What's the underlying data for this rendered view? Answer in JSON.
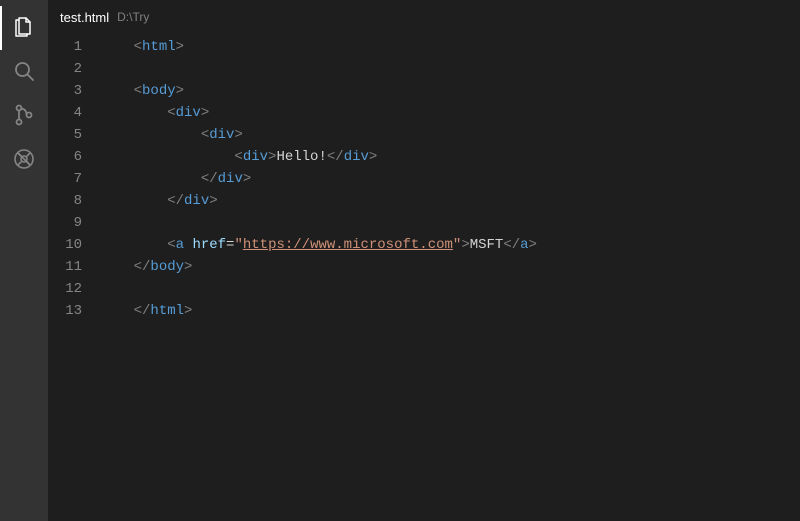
{
  "activityBar": {
    "items": [
      {
        "name": "explorer",
        "active": true
      },
      {
        "name": "search",
        "active": false
      },
      {
        "name": "sourceControl",
        "active": false
      },
      {
        "name": "debug",
        "active": false
      }
    ]
  },
  "tab": {
    "filename": "test.html",
    "pathLabel": "D:\\Try"
  },
  "editor": {
    "lineNumbers": [
      "1",
      "2",
      "3",
      "4",
      "5",
      "6",
      "7",
      "8",
      "9",
      "10",
      "11",
      "12",
      "13"
    ],
    "lines": [
      {
        "indent": 1,
        "segs": [
          {
            "t": "<",
            "c": "punc"
          },
          {
            "t": "html",
            "c": "tag"
          },
          {
            "t": ">",
            "c": "punc"
          }
        ]
      },
      {
        "indent": 0,
        "segs": []
      },
      {
        "indent": 1,
        "segs": [
          {
            "t": "<",
            "c": "punc"
          },
          {
            "t": "body",
            "c": "tag"
          },
          {
            "t": ">",
            "c": "punc"
          }
        ]
      },
      {
        "indent": 2,
        "segs": [
          {
            "t": "<",
            "c": "punc"
          },
          {
            "t": "div",
            "c": "tag"
          },
          {
            "t": ">",
            "c": "punc"
          }
        ]
      },
      {
        "indent": 3,
        "segs": [
          {
            "t": "<",
            "c": "punc"
          },
          {
            "t": "div",
            "c": "tag"
          },
          {
            "t": ">",
            "c": "punc"
          }
        ]
      },
      {
        "indent": 4,
        "segs": [
          {
            "t": "<",
            "c": "punc"
          },
          {
            "t": "div",
            "c": "tag"
          },
          {
            "t": ">",
            "c": "punc"
          },
          {
            "t": "Hello!",
            "c": "text"
          },
          {
            "t": "</",
            "c": "punc"
          },
          {
            "t": "div",
            "c": "tag"
          },
          {
            "t": ">",
            "c": "punc"
          }
        ]
      },
      {
        "indent": 3,
        "segs": [
          {
            "t": "</",
            "c": "punc"
          },
          {
            "t": "div",
            "c": "tag"
          },
          {
            "t": ">",
            "c": "punc"
          }
        ]
      },
      {
        "indent": 2,
        "segs": [
          {
            "t": "</",
            "c": "punc"
          },
          {
            "t": "div",
            "c": "tag"
          },
          {
            "t": ">",
            "c": "punc"
          }
        ]
      },
      {
        "indent": 0,
        "segs": []
      },
      {
        "indent": 2,
        "segs": [
          {
            "t": "<",
            "c": "punc"
          },
          {
            "t": "a",
            "c": "tag"
          },
          {
            "t": " ",
            "c": "text"
          },
          {
            "t": "href",
            "c": "attr"
          },
          {
            "t": "=",
            "c": "text"
          },
          {
            "t": "\"",
            "c": "str"
          },
          {
            "t": "https://www.microsoft.com",
            "c": "url"
          },
          {
            "t": "\"",
            "c": "str"
          },
          {
            "t": ">",
            "c": "punc"
          },
          {
            "t": "MSFT",
            "c": "text"
          },
          {
            "t": "</",
            "c": "punc"
          },
          {
            "t": "a",
            "c": "tag"
          },
          {
            "t": ">",
            "c": "punc"
          }
        ]
      },
      {
        "indent": 1,
        "segs": [
          {
            "t": "</",
            "c": "punc"
          },
          {
            "t": "body",
            "c": "tag"
          },
          {
            "t": ">",
            "c": "punc"
          }
        ]
      },
      {
        "indent": 0,
        "segs": []
      },
      {
        "indent": 1,
        "segs": [
          {
            "t": "</",
            "c": "punc"
          },
          {
            "t": "html",
            "c": "tag"
          },
          {
            "t": ">",
            "c": "punc"
          }
        ]
      }
    ]
  }
}
